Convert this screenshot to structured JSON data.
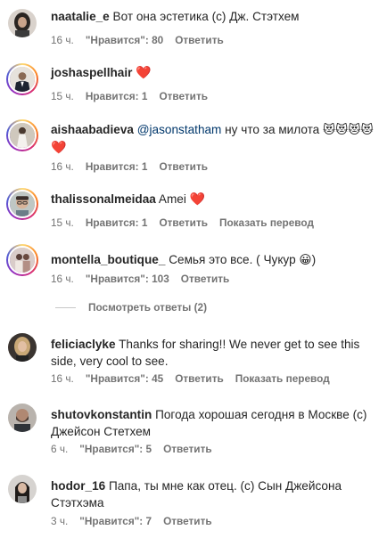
{
  "comments": [
    {
      "username": "naatalie_e",
      "text": "Вот она эстетика (с) Дж. Стэтхем",
      "time": "16 ч.",
      "likes": "\"Нравится\": 80",
      "reply": "Ответить",
      "avatar_icon": "avatar-woman-dark-hair"
    },
    {
      "username": "joshaspellhair",
      "text": "",
      "heart": "❤️",
      "time": "15 ч.",
      "likes": "Нравится: 1",
      "reply": "Ответить",
      "avatar_icon": "avatar-man-suit"
    },
    {
      "username": "aishaabadieva",
      "mention": "@jasonstatham",
      "text": "ну что за милота",
      "emoji": "😻😻😻😻",
      "heart": "❤️",
      "time": "16 ч.",
      "likes": "Нравится: 1",
      "reply": "Ответить",
      "avatar_icon": "avatar-woman-white-dress"
    },
    {
      "username": "thalissonalmeidaa",
      "text": "Amei",
      "heart": "❤️",
      "time": "15 ч.",
      "likes": "Нравится: 1",
      "reply": "Ответить",
      "translate": "Показать перевод",
      "avatar_icon": "avatar-man-glasses"
    },
    {
      "username": "montella_boutique_",
      "text": "Семья это все. ( Чукур",
      "emoji": "😀",
      "text_end": ")",
      "time": "16 ч.",
      "likes": "\"Нравится\": 103",
      "reply": "Ответить",
      "avatar_icon": "avatar-boutique"
    },
    {
      "username": "feliciaclyke",
      "text": "Thanks for sharing!! We never get to see this",
      "text_line2": "side, very cool to see.",
      "time": "16 ч.",
      "likes": "\"Нравится\": 45",
      "reply": "Ответить",
      "translate": "Показать перевод",
      "avatar_icon": "avatar-woman-blonde"
    },
    {
      "username": "shutovkonstantin",
      "text": "Погода хорошая сегодня в Москве (с)",
      "text_line2": "Джейсон Стетхем",
      "time": "6 ч.",
      "likes": "\"Нравится\": 5",
      "reply": "Ответить",
      "avatar_icon": "avatar-man-beard"
    },
    {
      "username": "hodor_16",
      "text": "Папа, ты мне как отец. (с) Сын Джейсона",
      "text_line2": "Стэтхэма",
      "time": "3 ч.",
      "likes": "\"Нравится\": 7",
      "reply": "Ответить",
      "avatar_icon": "avatar-woman-long-hair"
    }
  ],
  "view_replies": "Посмотреть ответы (2)"
}
